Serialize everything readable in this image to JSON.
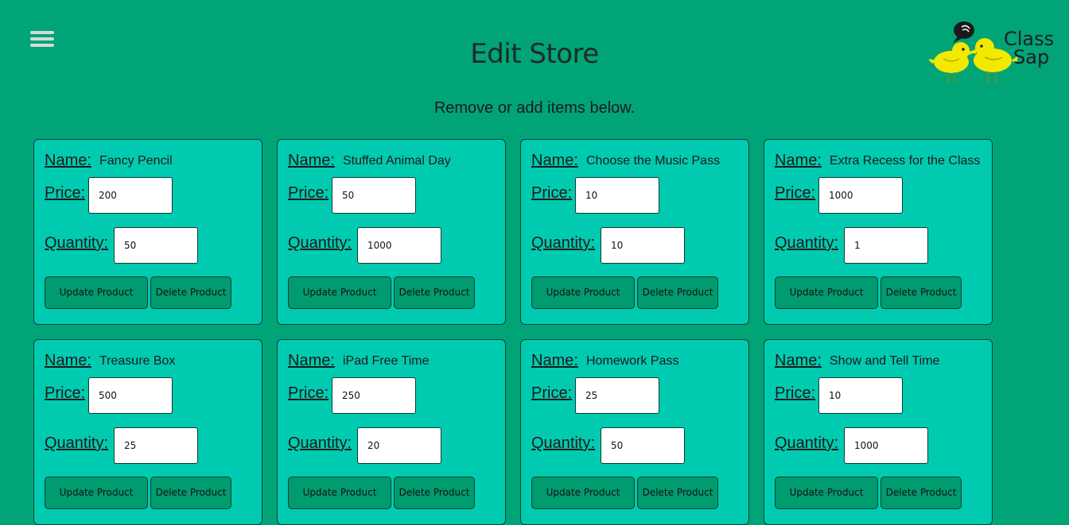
{
  "header": {
    "title": "Edit Store",
    "subtitle": "Remove or add items below."
  },
  "logo": {
    "line1": "Class",
    "line2": "Sap"
  },
  "labels": {
    "name": "Name:",
    "price": "Price:",
    "quantity": "Quantity:"
  },
  "buttons": {
    "update": "Update Product",
    "delete": "Delete Product"
  },
  "colors": {
    "background": "#00a477",
    "card": "#00cbb0",
    "button": "#009b6e",
    "logo_bird": "#f2e800"
  },
  "products": [
    {
      "name": "Fancy Pencil",
      "price": "200",
      "quantity": "50"
    },
    {
      "name": "Stuffed Animal Day",
      "price": "50",
      "quantity": "1000"
    },
    {
      "name": "Choose the Music Pass",
      "price": "10",
      "quantity": "10"
    },
    {
      "name": "Extra Recess for the Class",
      "price": "1000",
      "quantity": "1"
    },
    {
      "name": "Treasure Box",
      "price": "500",
      "quantity": "25"
    },
    {
      "name": "iPad Free Time",
      "price": "250",
      "quantity": "20"
    },
    {
      "name": "Homework Pass",
      "price": "25",
      "quantity": "50"
    },
    {
      "name": "Show and Tell Time",
      "price": "10",
      "quantity": "1000"
    }
  ]
}
